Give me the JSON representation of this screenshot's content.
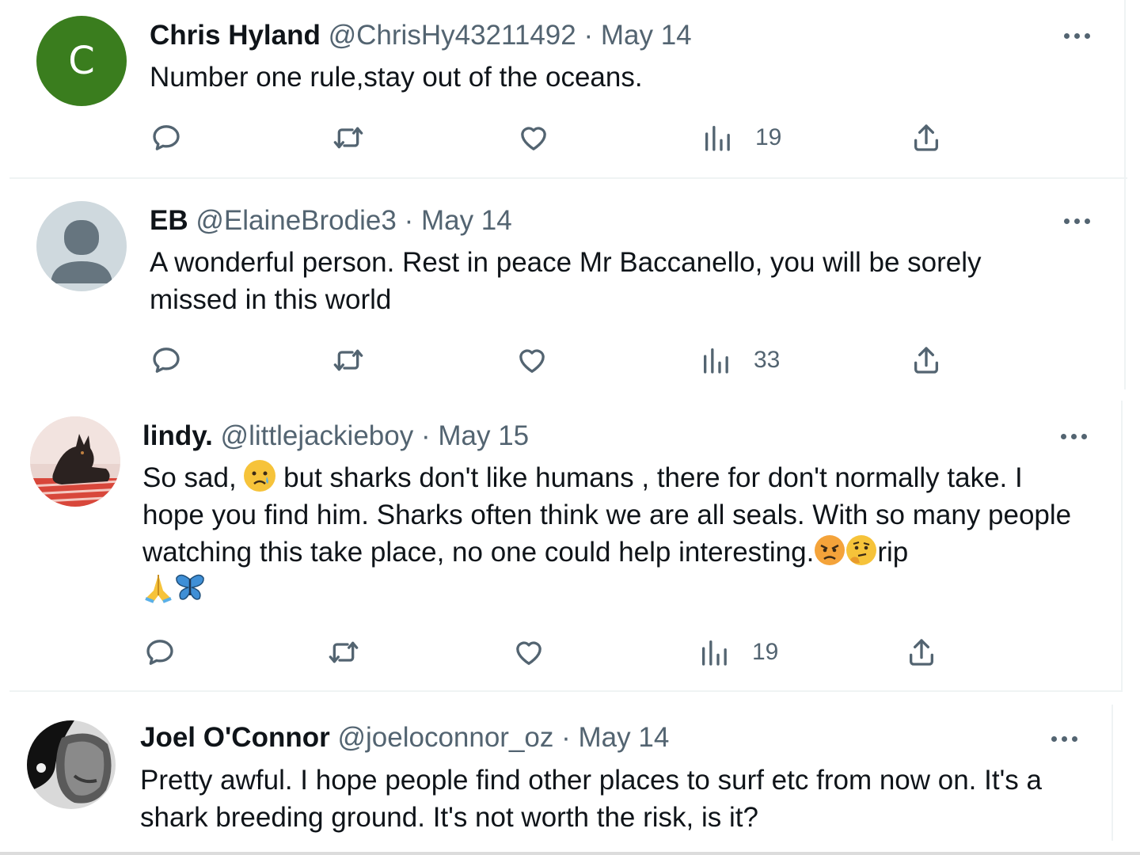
{
  "tweets": [
    {
      "name": "Chris Hyland",
      "handle": "@ChrisHy43211492",
      "separator": "·",
      "date": "May 14",
      "avatar_letter": "C",
      "avatar_color": "#3a7d1e",
      "text": "Number one rule,stay out of the oceans.",
      "views": "19"
    },
    {
      "name": "EB",
      "handle": "@ElaineBrodie3",
      "separator": "·",
      "date": "May 14",
      "avatar_color": "#cfd9de",
      "text": "A wonderful person. Rest in peace Mr Baccanello, you will be sorely missed in this world",
      "views": "33"
    },
    {
      "name": "lindy.",
      "handle": "@littlejackieboy",
      "separator": "·",
      "date": "May 15",
      "text_part1": "So sad,",
      "text_part2": "but sharks don't like humans , there for don't normally take. I hope you find him. Sharks often think we are all seals. With so many people watching this take place, no one could help interesting.",
      "text_part3": "rip",
      "emojis": [
        "sad-tear-emoji",
        "angry-emoji",
        "thinking-emoji",
        "folded-hands-emoji",
        "butterfly-emoji"
      ],
      "views": "19"
    },
    {
      "name": "Joel O'Connor",
      "handle": "@joeloconnor_oz",
      "separator": "·",
      "date": "May 14",
      "text": "Pretty awful. I hope people find other places to surf etc from now on. It's a shark breeding ground. It's not worth the risk, is it?"
    }
  ],
  "icons": [
    "reply-icon",
    "retweet-icon",
    "like-icon",
    "views-icon",
    "share-icon",
    "more-icon"
  ],
  "colors": {
    "secondary_text": "#536471",
    "primary_text": "#0f1419",
    "divider": "#eff3f4"
  }
}
